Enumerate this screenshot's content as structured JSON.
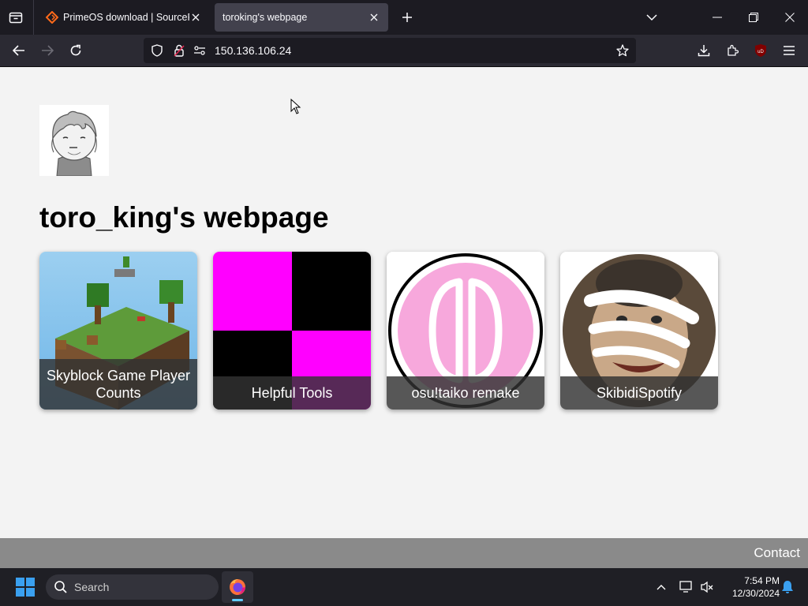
{
  "browser": {
    "tabs": [
      {
        "title": "PrimeOS download | SourceForge.net",
        "active": false
      },
      {
        "title": "toroking's webpage",
        "active": true
      }
    ],
    "url": "150.136.106.24"
  },
  "page": {
    "title": "toro_king's webpage",
    "cards": [
      {
        "label": "Skyblock Game Player Counts"
      },
      {
        "label": "Helpful Tools"
      },
      {
        "label": "osu!taiko remake"
      },
      {
        "label": "SkibidiSpotify"
      }
    ],
    "footer": {
      "contact_label": "Contact"
    }
  },
  "taskbar": {
    "search_placeholder": "Search",
    "time": "7:54 PM",
    "date": "12/30/2024"
  },
  "colors": {
    "tab_bar": "#1c1b22",
    "nav_bar": "#2b2a33",
    "page_bg": "#f3f3f3",
    "footer_bg": "#8a8a8a",
    "magenta": "#ff00ff",
    "taiko_pink": "#f7a8dc"
  },
  "icons": [
    "tab-list-icon",
    "sourceforge-icon",
    "close-icon",
    "plus-icon",
    "chevron-down-icon",
    "minimize-icon",
    "restore-icon",
    "back-icon",
    "forward-icon",
    "reload-icon",
    "shield-icon",
    "lock-icon",
    "permissions-icon",
    "bookmark-star-icon",
    "download-icon",
    "extensions-icon",
    "ublock-icon",
    "menu-icon",
    "windows-start-icon",
    "search-icon",
    "firefox-icon",
    "chevron-up-icon",
    "network-icon",
    "volume-mute-icon",
    "bell-icon"
  ]
}
